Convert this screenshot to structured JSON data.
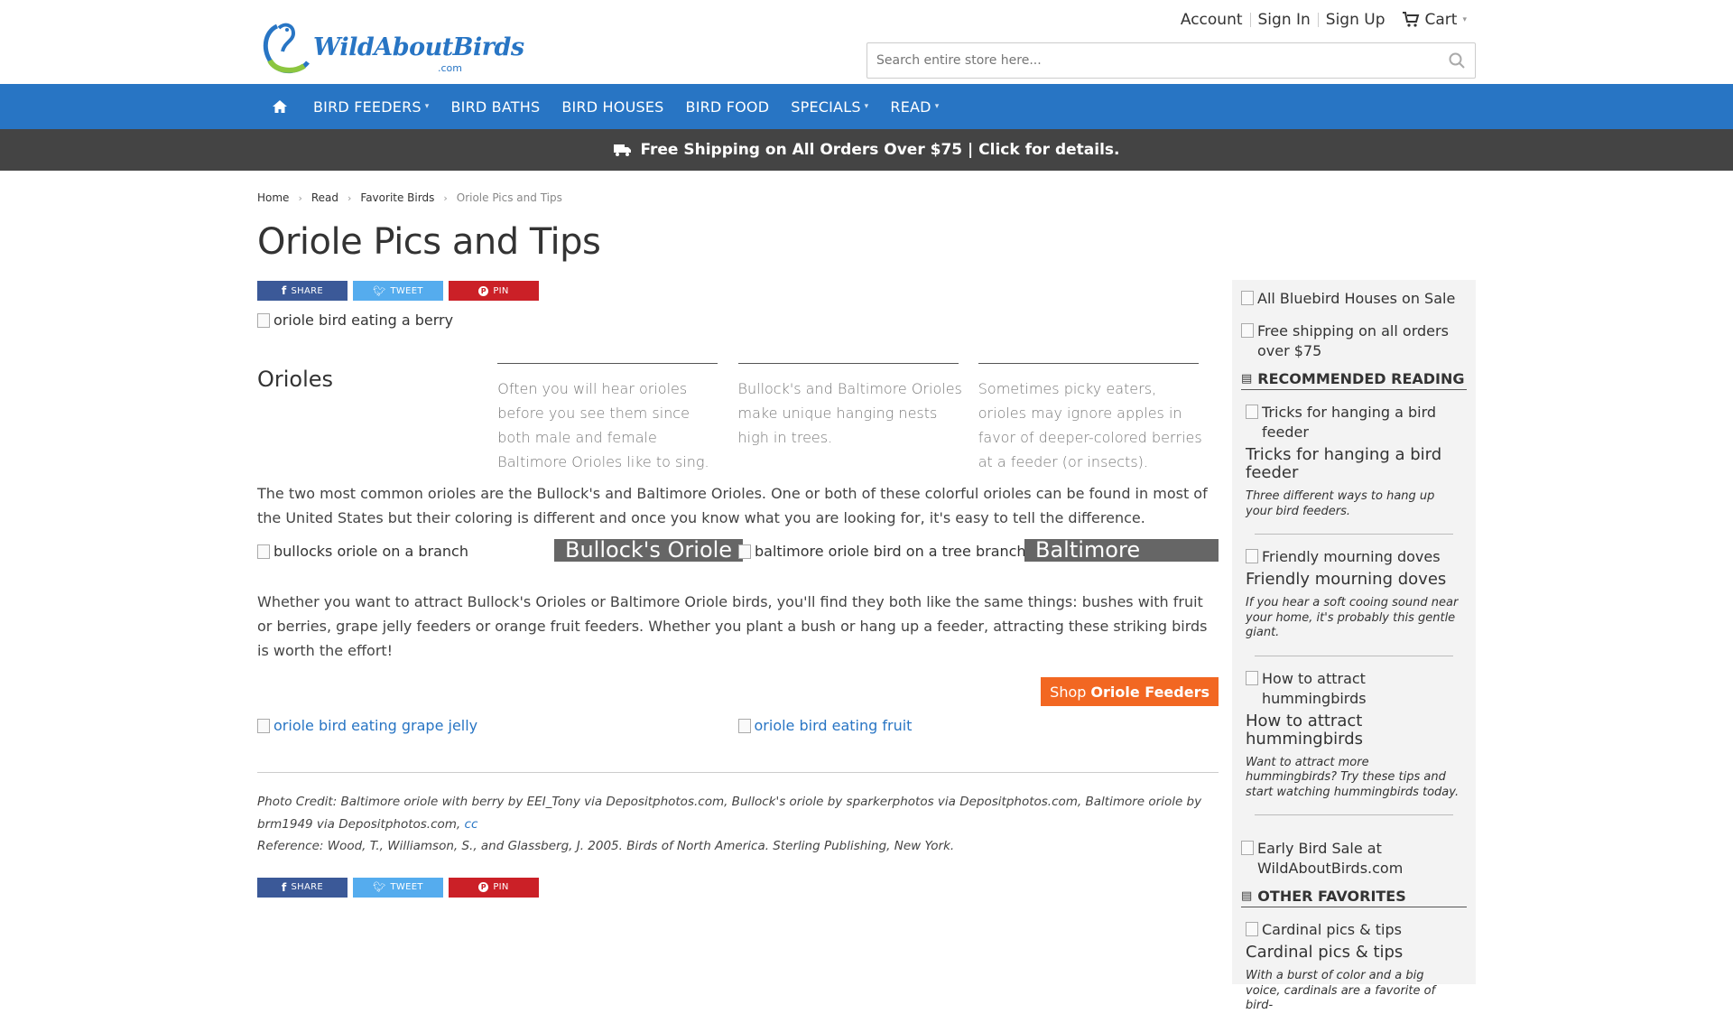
{
  "header": {
    "logo_text": "WildAboutBirds",
    "logo_domain": ".com",
    "account": "Account",
    "sign_in": "Sign In",
    "sign_up": "Sign Up",
    "cart": "Cart",
    "search_placeholder": "Search entire store here..."
  },
  "nav": {
    "items": [
      {
        "label": "BIRD FEEDERS",
        "dropdown": true
      },
      {
        "label": "BIRD BATHS",
        "dropdown": false
      },
      {
        "label": "BIRD HOUSES",
        "dropdown": false
      },
      {
        "label": "BIRD FOOD",
        "dropdown": false
      },
      {
        "label": "SPECIALS",
        "dropdown": true
      },
      {
        "label": "READ",
        "dropdown": true
      }
    ]
  },
  "promo": "Free Shipping on All Orders Over $75 | Click for details.",
  "breadcrumb": [
    "Home",
    "Read",
    "Favorite Birds",
    "Oriole Pics and Tips"
  ],
  "page_title": "Oriole Pics and Tips",
  "share": {
    "share": "SHARE",
    "tweet": "TWEET",
    "pin": "PIN"
  },
  "hero_alt": "oriole bird eating a berry",
  "section_title": "Orioles",
  "facts": [
    "Often you will hear orioles before you see them since both male and female Baltimore Orioles like to sing.",
    "Bullock's and Baltimore Orioles make unique hanging nests high in trees.",
    "Sometimes picky eaters, orioles may ignore apples in favor of deeper-colored berries at a feeder (or insects)."
  ],
  "intro": "The two most common orioles are the Bullock's and Baltimore Orioles. One or both of these colorful orioles can be found in most of the United States but their coloring is different and once you know what you are looking for, it's easy to tell the difference.",
  "species": [
    {
      "alt": "bullocks oriole on a branch",
      "caption": "Bullock's Oriole"
    },
    {
      "alt": "baltimore oriole bird on a tree branch",
      "caption": "Baltimore Oriole"
    }
  ],
  "body": "Whether you want to attract Bullock's Orioles or Baltimore Oriole birds, you'll find they both like the same things: bushes with fruit or berries, grape jelly feeders or orange fruit feeders. Whether you plant a bush or hang up a feeder, attracting these striking birds is worth the effort!",
  "shop_button": {
    "prefix": "Shop",
    "strong": "Oriole Feeders"
  },
  "image_links": [
    "oriole bird eating grape jelly",
    "oriole bird eating fruit"
  ],
  "photo_credit": "Photo Credit: Baltimore oriole with berry by EEI_Tony via Depositphotos.com, Bullock's oriole by sparkerphotos via Depositphotos.com, Baltimore oriole by brm1949 via Depositphotos.com,",
  "photo_credit_link": "cc",
  "reference": "Reference: Wood, T., Williamson, S., and Glassberg, J. 2005. Birds of North America. Sterling Publishing, New York.",
  "sidebar": {
    "banner1": "All Bluebird Houses on Sale",
    "banner2": "Free shipping on all orders over $75",
    "recommended_heading": "RECOMMENDED READING",
    "recommended": [
      {
        "alt": "Tricks for hanging a bird feeder",
        "title": "Tricks for hanging a bird feeder",
        "desc": "Three different ways to hang up your bird feeders."
      },
      {
        "alt": "Friendly mourning doves",
        "title": "Friendly mourning doves",
        "desc": "If you hear a soft cooing sound near your home, it's probably this gentle giant."
      },
      {
        "alt": "How to attract hummingbirds",
        "title": "How to attract hummingbirds",
        "desc": "Want to attract more hummingbirds? Try these tips and start watching hummingbirds today."
      }
    ],
    "banner3": "Early Bird Sale at WildAboutBirds.com",
    "favorites_heading": "OTHER FAVORITES",
    "favorites": [
      {
        "alt": "Cardinal pics & tips",
        "title": "Cardinal pics & tips",
        "desc": "With a burst of color and a big voice, cardinals are a favorite of bird-"
      }
    ]
  }
}
